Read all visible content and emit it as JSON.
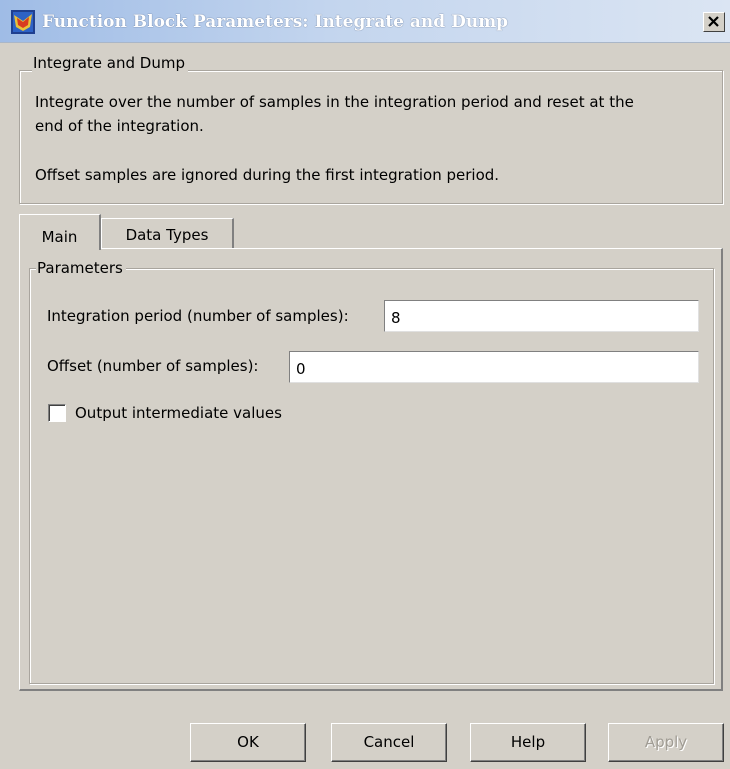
{
  "window": {
    "title": "Function Block Parameters: Integrate and Dump",
    "close_label": "X"
  },
  "description": {
    "group_title": "Integrate and Dump",
    "line1": "Integrate over the number of samples in the integration period and reset at the",
    "line2": "end of the integration.",
    "line3": "Offset samples are ignored during the first integration period."
  },
  "tabs": [
    {
      "label": "Main",
      "selected": true
    },
    {
      "label": "Data Types",
      "selected": false
    }
  ],
  "parameters": {
    "group_title": "Parameters",
    "integration_period": {
      "label": "Integration period (number of samples):",
      "value": "8"
    },
    "offset": {
      "label": "Offset (number of samples):",
      "value": "0"
    },
    "output_intermediate": {
      "label": "Output intermediate values",
      "checked": false
    }
  },
  "buttons": {
    "ok": "OK",
    "cancel": "Cancel",
    "help": "Help",
    "apply": "Apply"
  },
  "colors": {
    "window_bg": "#d4d0c8",
    "title_gradient_start": "#9fbce6",
    "title_text": "#ffffff",
    "disabled_text": "#a09c94"
  }
}
